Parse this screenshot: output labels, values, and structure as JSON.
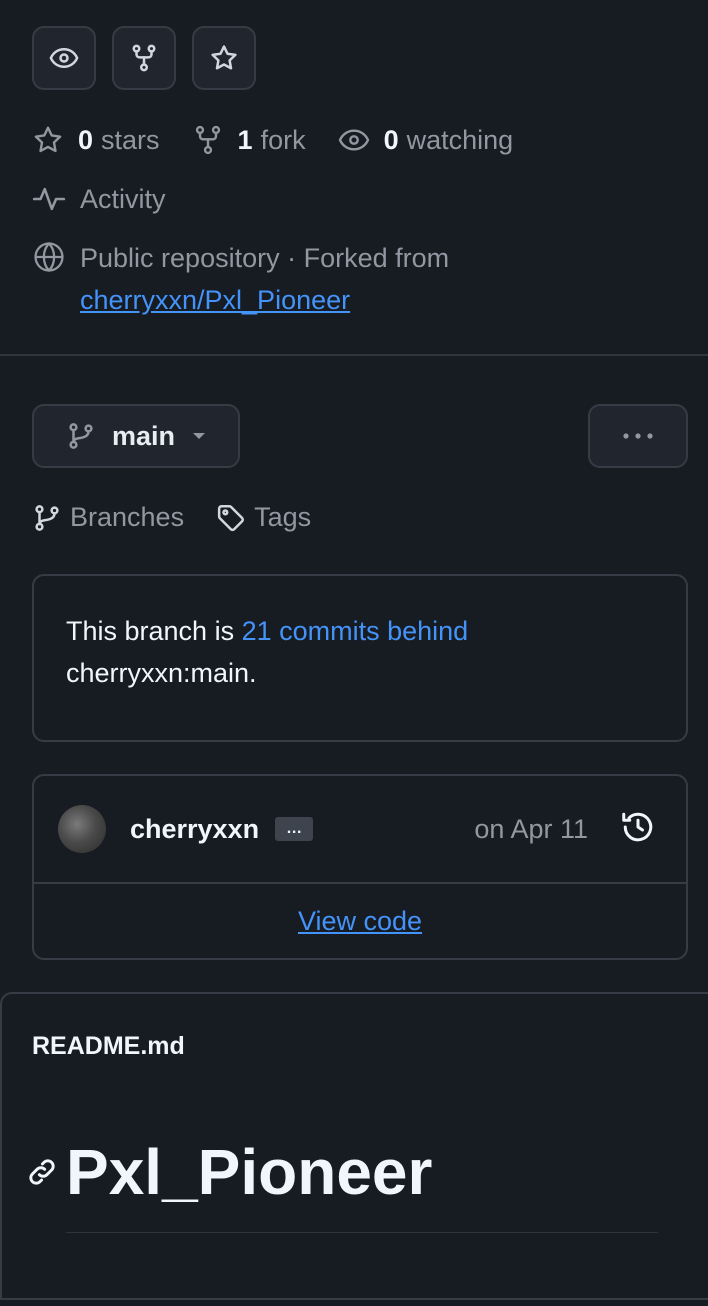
{
  "actions": [
    {
      "icon": "eye-icon"
    },
    {
      "icon": "fork-icon"
    },
    {
      "icon": "star-icon"
    }
  ],
  "stats": {
    "stars_count": "0",
    "stars_label": "stars",
    "forks_count": "1",
    "forks_label": "fork",
    "watching_count": "0",
    "watching_label": "watching"
  },
  "activity_label": "Activity",
  "repo_info": {
    "visibility_text": "Public repository · Forked from",
    "fork_source": "cherryxxn/Pxl_Pioneer"
  },
  "branch": {
    "current": "main",
    "branches_label": "Branches",
    "tags_label": "Tags"
  },
  "behind_notice": {
    "prefix": "This branch is ",
    "link": "21 commits behind",
    "suffix": "cherryxxn:main."
  },
  "last_commit": {
    "author": "cherryxxn",
    "ellipsis": "…",
    "date": "on Apr 11",
    "view_code": "View code"
  },
  "readme": {
    "filename": "README.md",
    "heading": "Pxl_Pioneer"
  },
  "colors": {
    "background": "#171b22",
    "border": "#363c45",
    "link": "#4493f8",
    "muted": "#9198a1",
    "text": "#f0f6fc"
  }
}
